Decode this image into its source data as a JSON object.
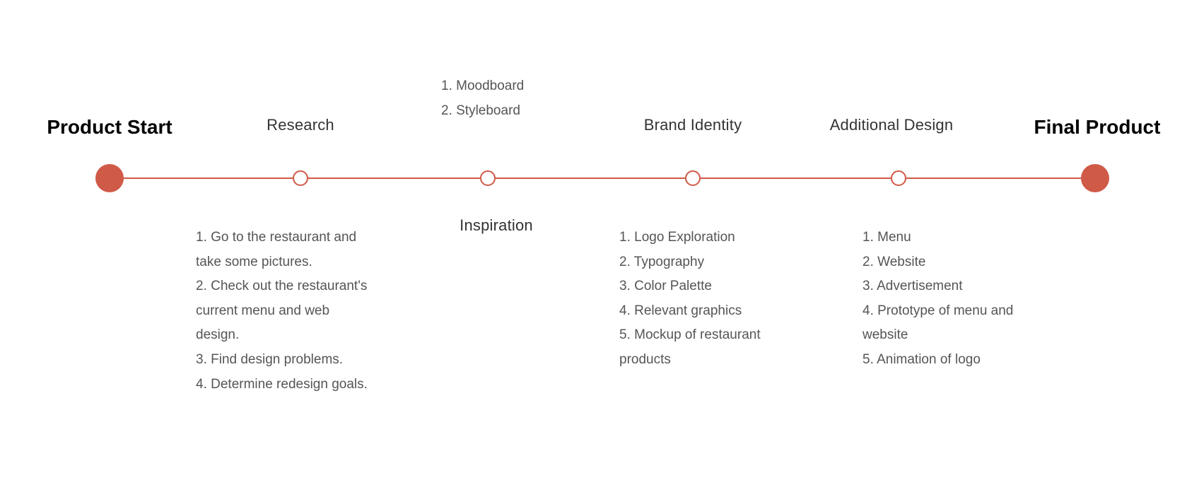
{
  "accent_color": "#d05a48",
  "start": {
    "label": "Product Start"
  },
  "end": {
    "label": "Final Product"
  },
  "steps": [
    {
      "label": "Research",
      "items": [
        "1.  Go to the restaurant and",
        "take some pictures.",
        "2. Check out the restaurant's",
        "current menu and web",
        "design.",
        "3. Find design problems.",
        "4. Determine redesign goals."
      ]
    },
    {
      "label": "Inspiration",
      "items": [
        "1.  Moodboard",
        "2. Styleboard"
      ]
    },
    {
      "label": "Brand Identity",
      "items": [
        "1.  Logo Exploration",
        "2. Typography",
        "3. Color Palette",
        "4. Relevant graphics",
        "5. Mockup of restaurant",
        "products"
      ]
    },
    {
      "label": "Additional Design",
      "items": [
        "1.  Menu",
        "2. Website",
        "3. Advertisement",
        "4. Prototype of menu and",
        "website",
        "5. Animation of logo"
      ]
    }
  ]
}
